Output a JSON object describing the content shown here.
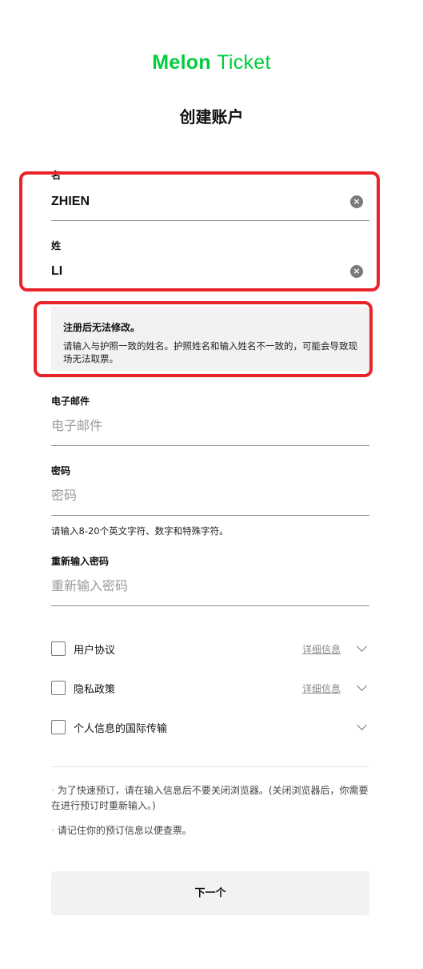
{
  "logo": {
    "word1": "Melon",
    "word2": "Ticket"
  },
  "page_title": "创建账户",
  "first_name": {
    "label": "名",
    "value": "ZHIEN"
  },
  "last_name": {
    "label": "姓",
    "value": "LI"
  },
  "notice": {
    "title": "注册后无法修改。",
    "body": "请输入与护照一致的姓名。护照姓名和输入姓名不一致的，可能会导致现场无法取票。"
  },
  "email": {
    "label": "电子邮件",
    "placeholder": "电子邮件"
  },
  "password": {
    "label": "密码",
    "placeholder": "密码",
    "hint": "请输入8-20个英文字符、数字和特殊字符。"
  },
  "password_confirm": {
    "label": "重新输入密码",
    "placeholder": "重新输入密码"
  },
  "agreements": [
    {
      "label": "用户协议",
      "detail": "详细信息"
    },
    {
      "label": "隐私政策",
      "detail": "详细信息"
    },
    {
      "label": "个人信息的国际传输"
    }
  ],
  "bullets": [
    "为了快速预订，请在输入信息后不要关闭浏览器。(关闭浏览器后，你需要在进行预订时重新输入。)",
    "请记住你的预订信息以便查票。"
  ],
  "next_button": "下一个",
  "colors": {
    "brand": "#00cd3c",
    "highlight": "#e8242b"
  }
}
